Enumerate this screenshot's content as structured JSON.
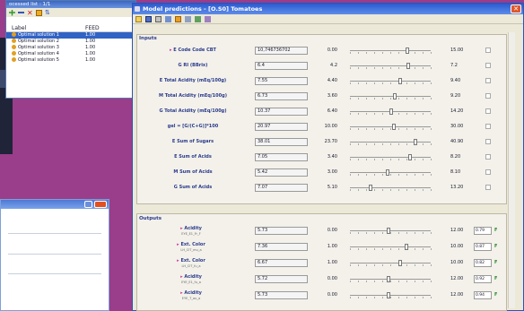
{
  "list_window": {
    "title": "ocessed list : 1/1",
    "headers": [
      "Label",
      "FEED"
    ],
    "rows": [
      {
        "label": "Optimal solution 1",
        "value": "1.00"
      },
      {
        "label": "Optimal solution 2",
        "value": "1.00"
      },
      {
        "label": "Optimal solution 3",
        "value": "1.00"
      },
      {
        "label": "Optimal solution 4",
        "value": "1.00"
      },
      {
        "label": "Optimal solution 5",
        "value": "1.00"
      }
    ]
  },
  "main_window": {
    "title": "Model predictions - [O.S0] Tomatoes",
    "inputs_title": "Inputs",
    "outputs_title": "Outputs",
    "inputs": [
      {
        "label": "E Code Code CBT",
        "arrow": "▸",
        "value": "10,746736702",
        "min": "0.00",
        "max": "15.00",
        "pos": 0.72
      },
      {
        "label": "G RI (BBrix)",
        "value": "6.4",
        "min": "4.2",
        "max": "7.2",
        "pos": 0.73
      },
      {
        "label": "E Total Acidity (mEq/100g)",
        "value": "7.55",
        "min": "4.40",
        "max": "9.40",
        "pos": 0.63
      },
      {
        "label": "M Total Acidity (mEq/100g)",
        "value": "6.73",
        "min": "3.60",
        "max": "9.20",
        "pos": 0.56
      },
      {
        "label": "G Total Acidity (mEq/100g)",
        "value": "10.37",
        "min": "6.40",
        "max": "14.20",
        "pos": 0.51
      },
      {
        "label": "gel = [G/(C+G)]*100",
        "value": "20.97",
        "min": "10.00",
        "max": "30.00",
        "pos": 0.55
      },
      {
        "label": "E Sum of Sugars",
        "value": "38.01",
        "min": "23.70",
        "max": "40.90",
        "pos": 0.83
      },
      {
        "label": "E Sum of Acids",
        "value": "7.05",
        "min": "3.40",
        "max": "8.20",
        "pos": 0.76
      },
      {
        "label": "M Sum of Acids",
        "value": "5.42",
        "min": "3.00",
        "max": "8.10",
        "pos": 0.47
      },
      {
        "label": "G Sum of Acids",
        "value": "7.07",
        "min": "5.10",
        "max": "13.20",
        "pos": 0.24
      }
    ],
    "outputs": [
      {
        "label": "Acidity",
        "sub": "EYE_E1_Fr_F",
        "value": "5.73",
        "min": "0.00",
        "max": "12.00",
        "pos": 0.48,
        "out": "0.79",
        "flag": "F"
      },
      {
        "label": "Ext. Color",
        "sub": "LH_CIT_mu_a",
        "value": "7.36",
        "min": "1.00",
        "max": "10.00",
        "pos": 0.71,
        "out": "0.87",
        "flag": "F"
      },
      {
        "label": "Ext. Color",
        "sub": "LH_CIT_fu_a",
        "value": "6.67",
        "min": "1.00",
        "max": "10.00",
        "pos": 0.63,
        "out": "0.82",
        "flag": "F"
      },
      {
        "label": "Acidity",
        "sub": "EYE_E1_fu_a",
        "value": "5.72",
        "min": "0.00",
        "max": "12.00",
        "pos": 0.48,
        "out": "0.92",
        "flag": "F"
      },
      {
        "label": "Acidity",
        "sub": "EYE_T_au_a",
        "value": "5.73",
        "min": "0.00",
        "max": "12.00",
        "pos": 0.48,
        "out": "0.94",
        "flag": "F"
      }
    ]
  },
  "colors": {
    "desktop": "#9a3d8a",
    "titlebar": "#2a5bd1",
    "selection": "#3163c5",
    "label": "#2a3a8a"
  },
  "icons": [
    "add-icon",
    "remove-icon",
    "delete-icon",
    "grid-icon",
    "sort-icon",
    "save-icon",
    "print-icon",
    "open-icon",
    "chart-icon",
    "close-icon"
  ]
}
